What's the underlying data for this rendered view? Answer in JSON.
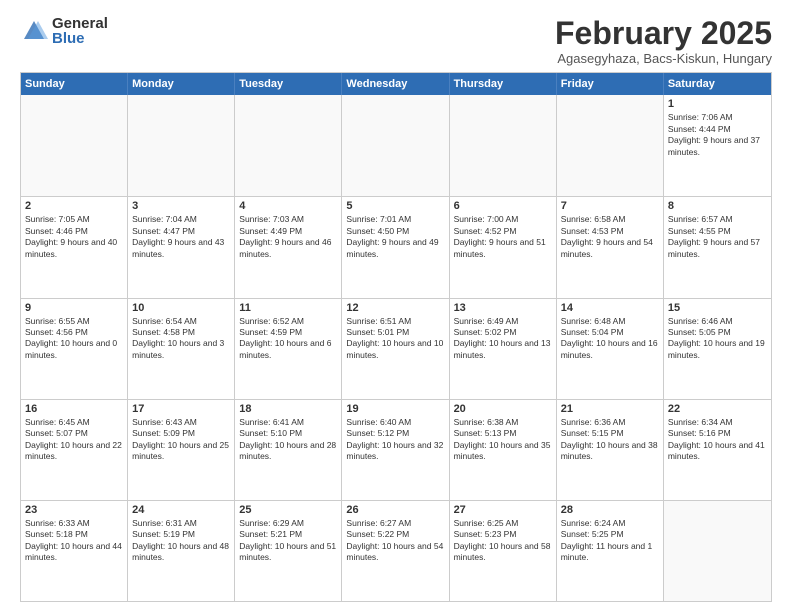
{
  "logo": {
    "general": "General",
    "blue": "Blue"
  },
  "title": "February 2025",
  "subtitle": "Agasegyhaza, Bacs-Kiskun, Hungary",
  "header_days": [
    "Sunday",
    "Monday",
    "Tuesday",
    "Wednesday",
    "Thursday",
    "Friday",
    "Saturday"
  ],
  "weeks": [
    [
      {
        "day": "",
        "text": ""
      },
      {
        "day": "",
        "text": ""
      },
      {
        "day": "",
        "text": ""
      },
      {
        "day": "",
        "text": ""
      },
      {
        "day": "",
        "text": ""
      },
      {
        "day": "",
        "text": ""
      },
      {
        "day": "1",
        "text": "Sunrise: 7:06 AM\nSunset: 4:44 PM\nDaylight: 9 hours and 37 minutes."
      }
    ],
    [
      {
        "day": "2",
        "text": "Sunrise: 7:05 AM\nSunset: 4:46 PM\nDaylight: 9 hours and 40 minutes."
      },
      {
        "day": "3",
        "text": "Sunrise: 7:04 AM\nSunset: 4:47 PM\nDaylight: 9 hours and 43 minutes."
      },
      {
        "day": "4",
        "text": "Sunrise: 7:03 AM\nSunset: 4:49 PM\nDaylight: 9 hours and 46 minutes."
      },
      {
        "day": "5",
        "text": "Sunrise: 7:01 AM\nSunset: 4:50 PM\nDaylight: 9 hours and 49 minutes."
      },
      {
        "day": "6",
        "text": "Sunrise: 7:00 AM\nSunset: 4:52 PM\nDaylight: 9 hours and 51 minutes."
      },
      {
        "day": "7",
        "text": "Sunrise: 6:58 AM\nSunset: 4:53 PM\nDaylight: 9 hours and 54 minutes."
      },
      {
        "day": "8",
        "text": "Sunrise: 6:57 AM\nSunset: 4:55 PM\nDaylight: 9 hours and 57 minutes."
      }
    ],
    [
      {
        "day": "9",
        "text": "Sunrise: 6:55 AM\nSunset: 4:56 PM\nDaylight: 10 hours and 0 minutes."
      },
      {
        "day": "10",
        "text": "Sunrise: 6:54 AM\nSunset: 4:58 PM\nDaylight: 10 hours and 3 minutes."
      },
      {
        "day": "11",
        "text": "Sunrise: 6:52 AM\nSunset: 4:59 PM\nDaylight: 10 hours and 6 minutes."
      },
      {
        "day": "12",
        "text": "Sunrise: 6:51 AM\nSunset: 5:01 PM\nDaylight: 10 hours and 10 minutes."
      },
      {
        "day": "13",
        "text": "Sunrise: 6:49 AM\nSunset: 5:02 PM\nDaylight: 10 hours and 13 minutes."
      },
      {
        "day": "14",
        "text": "Sunrise: 6:48 AM\nSunset: 5:04 PM\nDaylight: 10 hours and 16 minutes."
      },
      {
        "day": "15",
        "text": "Sunrise: 6:46 AM\nSunset: 5:05 PM\nDaylight: 10 hours and 19 minutes."
      }
    ],
    [
      {
        "day": "16",
        "text": "Sunrise: 6:45 AM\nSunset: 5:07 PM\nDaylight: 10 hours and 22 minutes."
      },
      {
        "day": "17",
        "text": "Sunrise: 6:43 AM\nSunset: 5:09 PM\nDaylight: 10 hours and 25 minutes."
      },
      {
        "day": "18",
        "text": "Sunrise: 6:41 AM\nSunset: 5:10 PM\nDaylight: 10 hours and 28 minutes."
      },
      {
        "day": "19",
        "text": "Sunrise: 6:40 AM\nSunset: 5:12 PM\nDaylight: 10 hours and 32 minutes."
      },
      {
        "day": "20",
        "text": "Sunrise: 6:38 AM\nSunset: 5:13 PM\nDaylight: 10 hours and 35 minutes."
      },
      {
        "day": "21",
        "text": "Sunrise: 6:36 AM\nSunset: 5:15 PM\nDaylight: 10 hours and 38 minutes."
      },
      {
        "day": "22",
        "text": "Sunrise: 6:34 AM\nSunset: 5:16 PM\nDaylight: 10 hours and 41 minutes."
      }
    ],
    [
      {
        "day": "23",
        "text": "Sunrise: 6:33 AM\nSunset: 5:18 PM\nDaylight: 10 hours and 44 minutes."
      },
      {
        "day": "24",
        "text": "Sunrise: 6:31 AM\nSunset: 5:19 PM\nDaylight: 10 hours and 48 minutes."
      },
      {
        "day": "25",
        "text": "Sunrise: 6:29 AM\nSunset: 5:21 PM\nDaylight: 10 hours and 51 minutes."
      },
      {
        "day": "26",
        "text": "Sunrise: 6:27 AM\nSunset: 5:22 PM\nDaylight: 10 hours and 54 minutes."
      },
      {
        "day": "27",
        "text": "Sunrise: 6:25 AM\nSunset: 5:23 PM\nDaylight: 10 hours and 58 minutes."
      },
      {
        "day": "28",
        "text": "Sunrise: 6:24 AM\nSunset: 5:25 PM\nDaylight: 11 hours and 1 minute."
      },
      {
        "day": "",
        "text": ""
      }
    ]
  ]
}
